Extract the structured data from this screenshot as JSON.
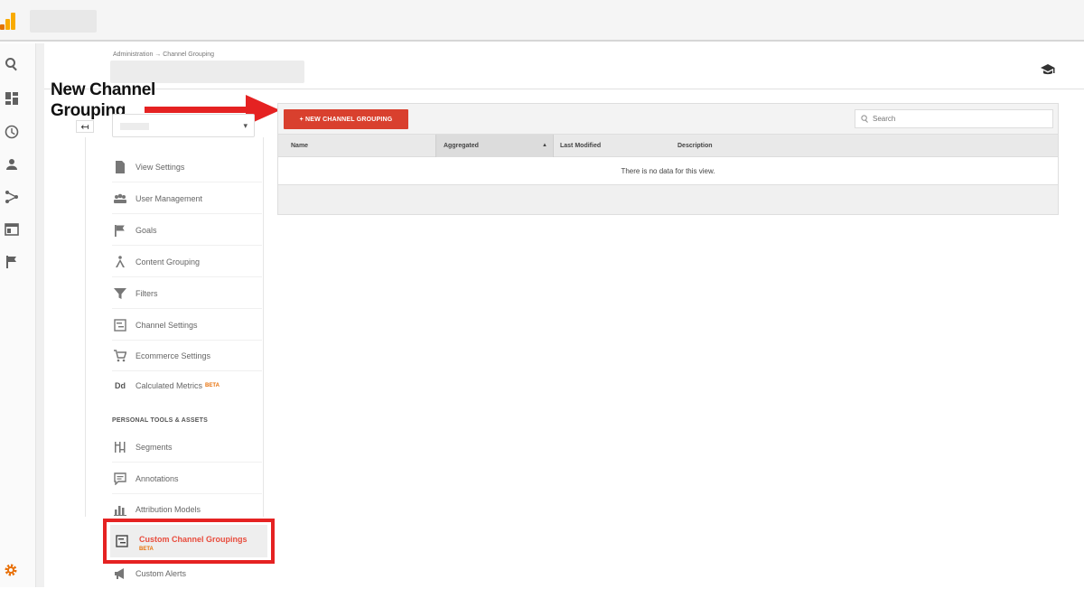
{
  "breadcrumb": "Administration → Channel Grouping",
  "annotation": {
    "line1": "New Channel",
    "line2": "Grouping",
    "color": "#e52222"
  },
  "rail_icons": [
    "search-icon",
    "dashboard-icon",
    "clock-icon",
    "person-icon",
    "acquisition-icon",
    "behavior-icon",
    "flag-icon"
  ],
  "view_select": {
    "chevron": "▾"
  },
  "back_button": "↤",
  "menu": {
    "items": [
      {
        "label": "View Settings",
        "icon": "document-icon"
      },
      {
        "label": "User Management",
        "icon": "users-icon"
      },
      {
        "label": "Goals",
        "icon": "flag-icon"
      },
      {
        "label": "Content Grouping",
        "icon": "content-grouping-icon"
      },
      {
        "label": "Filters",
        "icon": "filter-icon"
      },
      {
        "label": "Channel Settings",
        "icon": "channel-settings-icon"
      },
      {
        "label": "Ecommerce Settings",
        "icon": "cart-icon"
      },
      {
        "label": "Calculated Metrics",
        "icon": "calculated-metrics-icon",
        "badge": "BETA"
      }
    ],
    "section_header": "PERSONAL TOOLS & ASSETS",
    "tools": [
      {
        "label": "Segments",
        "icon": "segments-icon"
      },
      {
        "label": "Annotations",
        "icon": "annotation-icon"
      },
      {
        "label": "Attribution Models",
        "icon": "attribution-icon"
      }
    ],
    "active": {
      "label": "Custom Channel Groupings",
      "badge": "BETA",
      "icon": "channel-grouping-icon"
    },
    "after": [
      {
        "label": "Custom Alerts",
        "icon": "megaphone-icon"
      }
    ]
  },
  "table": {
    "new_button": "+ NEW CHANNEL GROUPING",
    "search_placeholder": "Search",
    "columns": [
      "Name",
      "Aggregated",
      "Last Modified",
      "Description"
    ],
    "sort_indicator": "▲",
    "empty_message": "There is no data for this view."
  },
  "colors": {
    "accent": "#d9402e",
    "active_text": "#e84c3d",
    "beta": "#e8710a",
    "logo": "#f9ab00"
  }
}
